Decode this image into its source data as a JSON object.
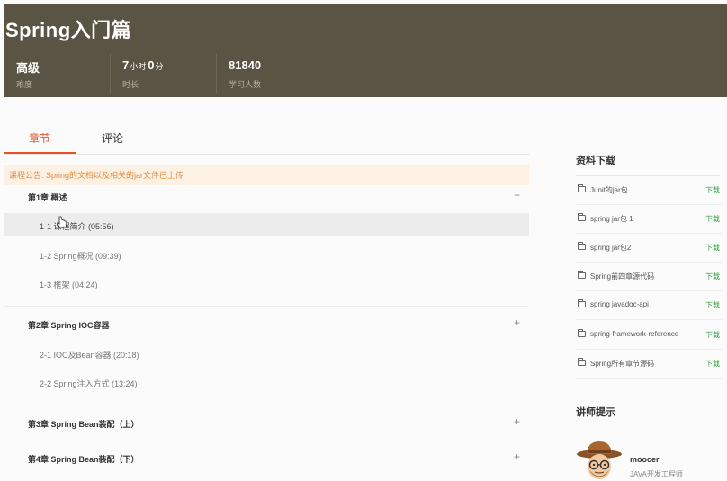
{
  "course": {
    "title": "Spring入门篇",
    "stats": {
      "level_value": "高级",
      "level_label": "难度",
      "duration_hours": "7",
      "duration_hours_unit": "小时",
      "duration_minutes": "0",
      "duration_minutes_unit": "分",
      "duration_label": "时长",
      "learners_value": "81840",
      "learners_label": "学习人数"
    }
  },
  "tabs": {
    "chapters": "章节",
    "comments": "评论"
  },
  "notice": "课程公告: Spring的文档以及相关的jar文件已上传",
  "chapters": [
    {
      "title": "第1章 概述",
      "toggle": "−",
      "lessons": [
        "1-1 课程简介 (05:56)",
        "1-2 Spring概况 (09:39)",
        "1-3 框架 (04:24)"
      ]
    },
    {
      "title": "第2章 Spring IOC容器",
      "toggle": "+",
      "lessons": [
        "2-1 IOC及Bean容器 (20:18)",
        "2-2 Spring注入方式 (13:24)"
      ]
    },
    {
      "title": "第3章 Spring Bean装配（上）",
      "toggle": "+",
      "lessons": []
    },
    {
      "title": "第4章 Spring Bean装配（下）",
      "toggle": "+",
      "lessons": []
    }
  ],
  "resources": {
    "title": "资料下载",
    "download_label": "下载",
    "icon": "folder-icon",
    "files": [
      "Junit的jar包",
      "spring jar包 1",
      "spring jar包2",
      "Spring前四章源代码",
      "spring javadoc-api",
      "spring-framework-reference",
      "Spring所有章节源码"
    ]
  },
  "teacher": {
    "section_title": "讲师提示",
    "name": "moocer",
    "role": "JAVA开发工程师"
  },
  "colors": {
    "banner": "#5a5444",
    "accent": "#e2552b",
    "download": "#2f9e3d",
    "notice_bg": "#fdf1e4"
  }
}
